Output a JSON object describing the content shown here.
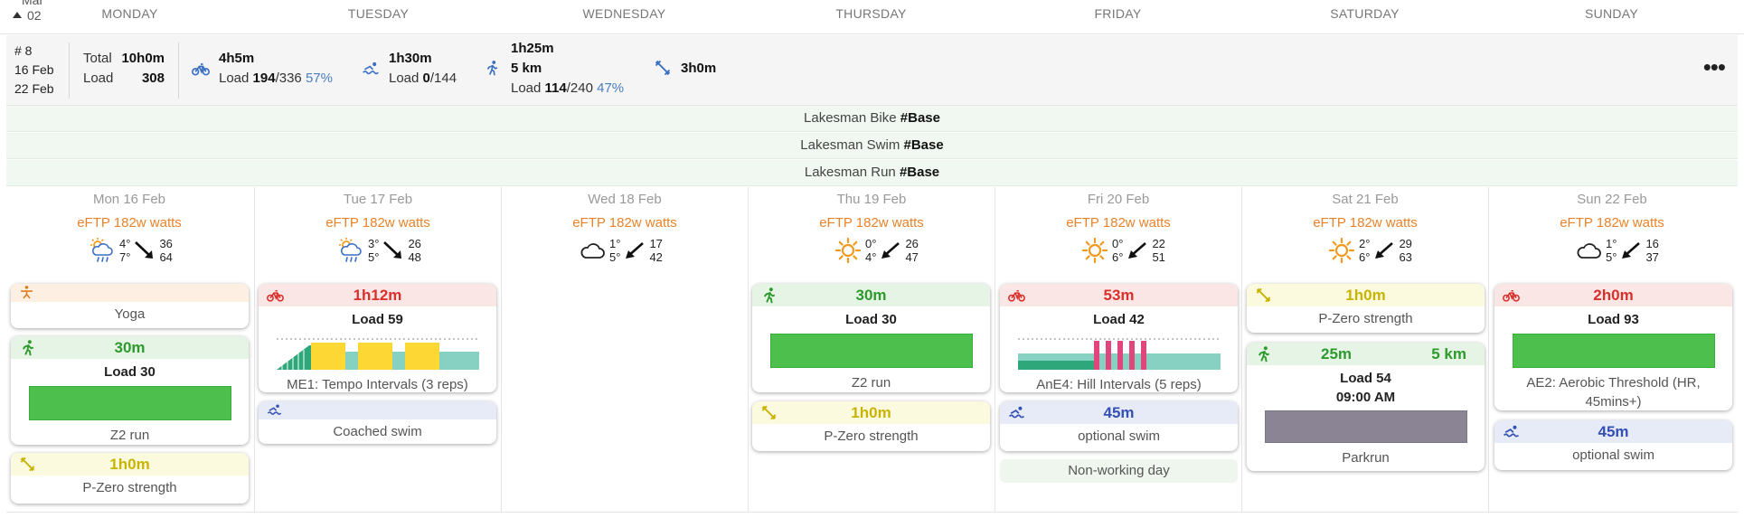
{
  "header": {
    "month": "Mar",
    "day": "02",
    "days": [
      "MONDAY",
      "TUESDAY",
      "WEDNESDAY",
      "THURSDAY",
      "FRIDAY",
      "SATURDAY",
      "SUNDAY"
    ]
  },
  "week": {
    "number": "# 8",
    "start": "16 Feb",
    "end": "22 Feb",
    "total_label": "Total",
    "total_value": "10h0m",
    "load_label": "Load",
    "load_value": "308",
    "bike": {
      "time": "4h5m",
      "load_label": "Load",
      "load": "194",
      "load_max": "/336",
      "pct": "57%"
    },
    "swim": {
      "time": "1h30m",
      "load_label": "Load",
      "load": "0",
      "load_max": "/144"
    },
    "run": {
      "time": "1h25m",
      "distance": "5 km",
      "load_label": "Load",
      "load": "114",
      "load_max": "/240",
      "pct": "47%"
    },
    "strength": {
      "time": "3h0m"
    },
    "more": "•••"
  },
  "plans": [
    {
      "name": "Lakesman Bike",
      "tag": "#Base"
    },
    {
      "name": "Lakesman Swim",
      "tag": "#Base"
    },
    {
      "name": "Lakesman Run",
      "tag": "#Base"
    }
  ],
  "days": [
    {
      "date": "Mon 16 Feb",
      "eftp": "eFTP 182w watts",
      "weather_icon": "partly-cloudy-rain-icon",
      "temp_hi": "4°",
      "temp_lo": "7°",
      "wind_a": "36",
      "wind_b": "64"
    },
    {
      "date": "Tue 17 Feb",
      "eftp": "eFTP 182w watts",
      "weather_icon": "partly-cloudy-rain-icon",
      "temp_hi": "3°",
      "temp_lo": "5°",
      "wind_a": "26",
      "wind_b": "48"
    },
    {
      "date": "Wed 18 Feb",
      "eftp": "eFTP 182w watts",
      "weather_icon": "cloud-icon",
      "temp_hi": "1°",
      "temp_lo": "5°",
      "wind_a": "17",
      "wind_b": "42"
    },
    {
      "date": "Thu 19 Feb",
      "eftp": "eFTP 182w watts",
      "weather_icon": "sun-icon",
      "temp_hi": "0°",
      "temp_lo": "4°",
      "wind_a": "26",
      "wind_b": "47"
    },
    {
      "date": "Fri 20 Feb",
      "eftp": "eFTP 182w watts",
      "weather_icon": "sun-icon",
      "temp_hi": "0°",
      "temp_lo": "6°",
      "wind_a": "22",
      "wind_b": "51"
    },
    {
      "date": "Sat 21 Feb",
      "eftp": "eFTP 182w watts",
      "weather_icon": "sun-icon",
      "temp_hi": "2°",
      "temp_lo": "6°",
      "wind_a": "29",
      "wind_b": "63"
    },
    {
      "date": "Sun 22 Feb",
      "eftp": "eFTP 182w watts",
      "weather_icon": "cloud-icon",
      "temp_hi": "1°",
      "temp_lo": "5°",
      "wind_a": "16",
      "wind_b": "37"
    }
  ],
  "workouts": {
    "mon_yoga": {
      "name": "Yoga"
    },
    "mon_run": {
      "duration": "30m",
      "load": "Load 30",
      "name": "Z2 run"
    },
    "mon_str": {
      "duration": "1h0m",
      "name": "P-Zero strength"
    },
    "tue_bike": {
      "duration": "1h12m",
      "load": "Load 59",
      "name": "ME1: Tempo Intervals (3 reps)"
    },
    "tue_swim": {
      "name": "Coached swim"
    },
    "thu_run": {
      "duration": "30m",
      "load": "Load 30",
      "name": "Z2 run"
    },
    "thu_str": {
      "duration": "1h0m",
      "name": "P-Zero strength"
    },
    "fri_bike": {
      "duration": "53m",
      "load": "Load 42",
      "name": "AnE4: Hill Intervals (5 reps)"
    },
    "fri_swim": {
      "duration": "45m",
      "name": "optional swim"
    },
    "fri_nonwork": {
      "name": "Non-working day"
    },
    "sat_str": {
      "duration": "1h0m",
      "name": "P-Zero strength"
    },
    "sat_run": {
      "duration": "25m",
      "distance": "5 km",
      "load": "Load 54",
      "time": "09:00 AM",
      "name": "Parkrun"
    },
    "sun_bike": {
      "duration": "2h0m",
      "load": "Load 93",
      "name": "AE2: Aerobic Threshold (HR, 45mins+)"
    },
    "sun_swim": {
      "duration": "45m",
      "name": "optional swim"
    }
  },
  "colors": {
    "run_green": "#4cbf4c",
    "tempo_yellow": "#fdd835",
    "endurance_teal": "#86d1c2",
    "hill_pink": "#e0457b",
    "parkrun_gray": "#8a8494",
    "eftp_orange": "#e8832a"
  }
}
